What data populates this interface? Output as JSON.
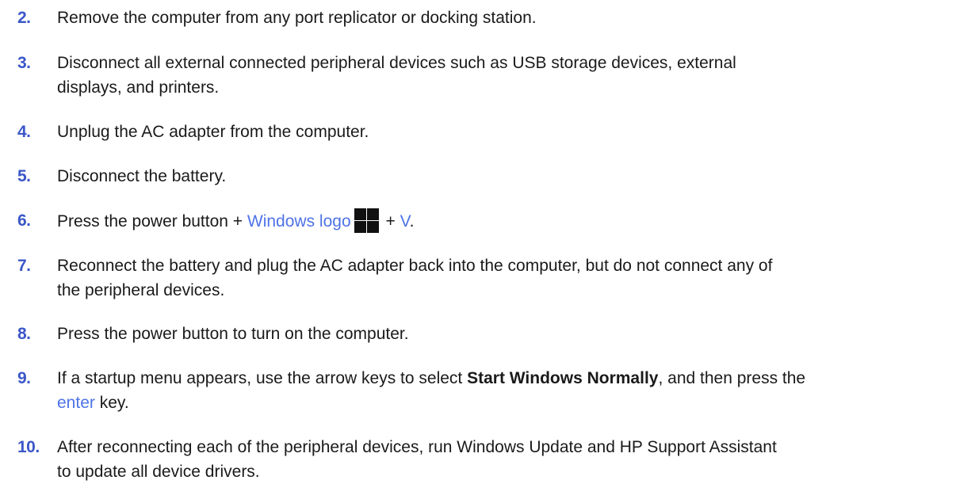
{
  "steps": [
    {
      "number": "2.",
      "text": "Remove the computer from any port replicator or docking station."
    },
    {
      "number": "3.",
      "line1": "Disconnect all external connected peripheral devices such as USB storage devices, external",
      "line2": "displays, and printers."
    },
    {
      "number": "4.",
      "text": "Unplug the AC adapter from the computer."
    },
    {
      "number": "5.",
      "text": "Disconnect the battery."
    },
    {
      "number": "6.",
      "pre": "Press the power button + ",
      "link1": "Windows logo",
      "sep": " + ",
      "link2": "V",
      "post": "."
    },
    {
      "number": "7.",
      "line1": "Reconnect the battery and plug the AC adapter back into the computer, but do not connect any of",
      "line2": "the peripheral devices."
    },
    {
      "number": "8.",
      "text": "Press the power button to turn on the computer."
    },
    {
      "number": "9.",
      "pre": "If a startup menu appears, use the arrow keys to select ",
      "bold": "Start Windows Normally",
      "mid": ", and then press the",
      "link": "enter",
      "post": " key."
    },
    {
      "number": "10.",
      "line1": "After reconnecting each of the peripheral devices, run Windows Update and HP Support Assistant",
      "line2": "to update all device drivers."
    }
  ],
  "icons": {
    "windows_logo": "windows-logo-icon"
  },
  "colors": {
    "number": "#3b57c8",
    "link": "#4e73e6",
    "text": "#1a1a1a"
  }
}
